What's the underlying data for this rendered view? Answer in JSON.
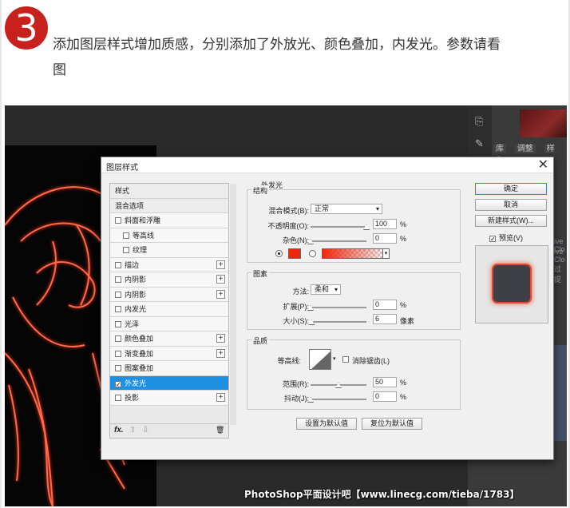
{
  "step": {
    "number": "3",
    "line1": "添加图层样式增加质感，分别添加了外放光、颜色叠加，内发光。参数请看",
    "line2": "图"
  },
  "photoshop": {
    "tabs": [
      "库",
      "调整",
      "样式"
    ],
    "faint_text_1": "ive Clo",
    "faint_text_2": "ive Clo",
    "faint_text_3": "过提"
  },
  "dialog": {
    "title": "图层样式",
    "close_glyph": "✕",
    "styles": [
      {
        "label": "样式",
        "checkbox": false,
        "plus": false,
        "indent": false,
        "header": true,
        "checked": false
      },
      {
        "label": "混合选项",
        "checkbox": false,
        "plus": false,
        "indent": false,
        "header": true,
        "checked": false
      },
      {
        "label": "斜面和浮雕",
        "checkbox": true,
        "plus": false,
        "indent": false,
        "header": false,
        "checked": false
      },
      {
        "label": "等高线",
        "checkbox": true,
        "plus": false,
        "indent": true,
        "header": false,
        "checked": false
      },
      {
        "label": "纹理",
        "checkbox": true,
        "plus": false,
        "indent": true,
        "header": false,
        "checked": false
      },
      {
        "label": "描边",
        "checkbox": true,
        "plus": true,
        "indent": false,
        "header": false,
        "checked": false
      },
      {
        "label": "内阴影",
        "checkbox": true,
        "plus": true,
        "indent": false,
        "header": false,
        "checked": false
      },
      {
        "label": "内阴影",
        "checkbox": true,
        "plus": true,
        "indent": false,
        "header": false,
        "checked": false
      },
      {
        "label": "内发光",
        "checkbox": true,
        "plus": false,
        "indent": false,
        "header": false,
        "checked": false
      },
      {
        "label": "光泽",
        "checkbox": true,
        "plus": false,
        "indent": false,
        "header": false,
        "checked": false
      },
      {
        "label": "颜色叠加",
        "checkbox": true,
        "plus": true,
        "indent": false,
        "header": false,
        "checked": false
      },
      {
        "label": "渐变叠加",
        "checkbox": true,
        "plus": true,
        "indent": false,
        "header": false,
        "checked": false
      },
      {
        "label": "图案叠加",
        "checkbox": true,
        "plus": false,
        "indent": false,
        "header": false,
        "checked": false
      },
      {
        "label": "外发光",
        "checkbox": true,
        "plus": false,
        "indent": false,
        "header": false,
        "checked": true,
        "selected": true
      },
      {
        "label": "投影",
        "checkbox": true,
        "plus": true,
        "indent": false,
        "header": false,
        "checked": false
      }
    ],
    "footer": {
      "fx": "fx.",
      "up": "⇧",
      "down": "⇩",
      "trash": "🗑"
    },
    "outer_glow": {
      "title": "外发光",
      "structure": {
        "title": "结构",
        "blend_mode_label": "混合模式(B):",
        "blend_mode_value": "正常",
        "opacity_label": "不透明度(O):",
        "opacity_value": "100",
        "opacity_level": 1.0,
        "noise_label": "杂色(N):",
        "noise_value": "0",
        "noise_level": 0.0,
        "color_hex": "#f0260a",
        "percent": "%"
      },
      "elements": {
        "title": "图素",
        "method_label": "方法:",
        "method_value": "柔和",
        "spread_label": "扩展(P):",
        "spread_value": "0",
        "spread_level": 0.0,
        "size_label": "大小(S):",
        "size_value": "6",
        "size_unit": "像素",
        "size_level": 0.02
      },
      "quality": {
        "title": "品质",
        "contour_label": "等高线:",
        "antialias_label": "消除锯齿(L)",
        "range_label": "范围(R):",
        "range_value": "50",
        "range_level": 0.5,
        "jitter_label": "抖动(J):",
        "jitter_value": "0",
        "jitter_level": 0.0
      },
      "make_default": "设置为默认值",
      "reset_default": "复位为默认值"
    },
    "buttons": {
      "ok": "确定",
      "cancel": "取消",
      "new_style": "新建样式(W)...",
      "preview": "预览(V)",
      "preview_checked": true
    }
  },
  "watermark": "PhotoShop平面设计吧【www.linecg.com/tieba/1783】"
}
